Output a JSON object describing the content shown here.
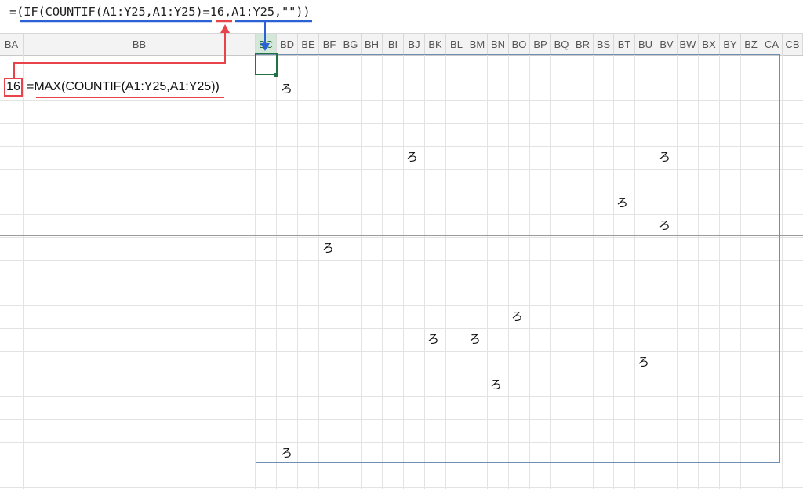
{
  "formula_bar": {
    "formula": "=(IF(COUNTIF(A1:Y25,A1:Y25)=16,A1:Y25,\"\"))"
  },
  "columns": [
    "BA",
    "BB",
    "BC",
    "BD",
    "BE",
    "BF",
    "BG",
    "BH",
    "BI",
    "BJ",
    "BK",
    "BL",
    "BM",
    "BN",
    "BO",
    "BP",
    "BQ",
    "BR",
    "BS",
    "BT",
    "BU",
    "BV",
    "BW",
    "BX",
    "BY",
    "BZ",
    "CA",
    "CB"
  ],
  "cells": {
    "ba_value": "16",
    "bb_formula": "=MAX(COUNTIF(A1:Y25,A1:Y25))",
    "char": "ろ"
  },
  "colors": {
    "annotation_red": "#e8434a",
    "annotation_blue": "#2a62d6",
    "selection_green": "#217346",
    "range_border": "#6f8fb2"
  }
}
